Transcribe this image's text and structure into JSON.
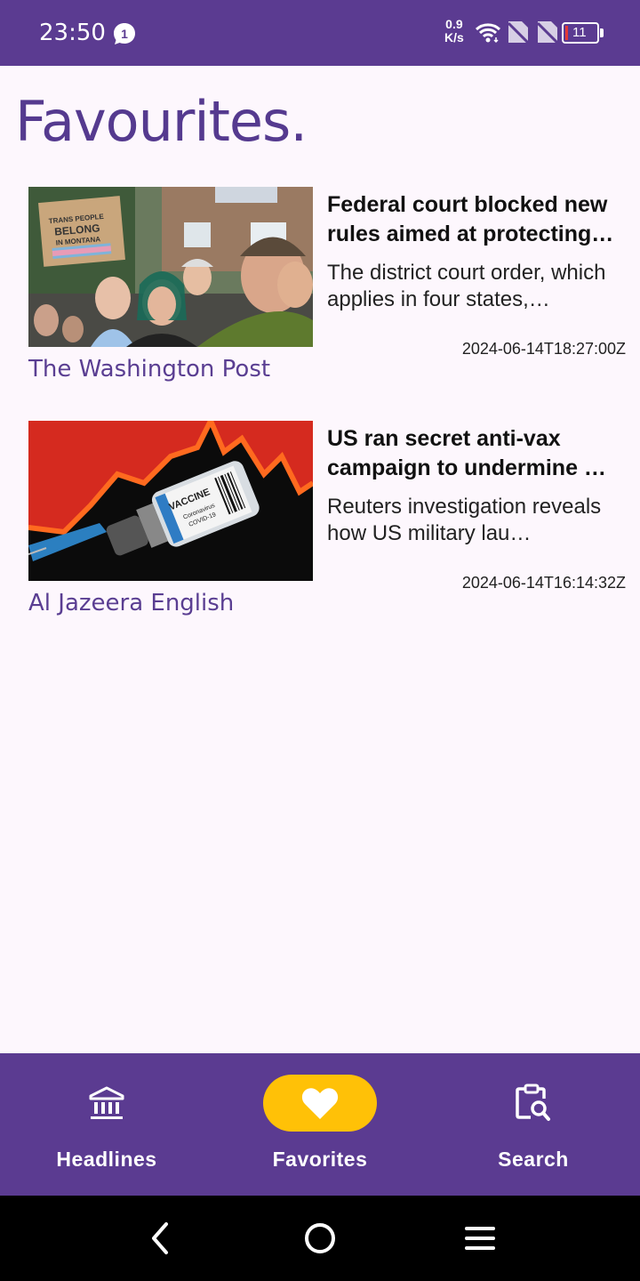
{
  "status_bar": {
    "time": "23:50",
    "notification_count": "1",
    "net_speed_value": "0.9",
    "net_speed_unit": "K/s",
    "battery_level": "11",
    "icons": [
      "message-bubble-icon",
      "wifi-icon",
      "no-sim-icon",
      "no-sim-icon",
      "battery-icon"
    ]
  },
  "page": {
    "title": "Favourites."
  },
  "articles": [
    {
      "headline": "Federal court blocked new rules aimed at protecting…",
      "summary": "The district court order, which applies in four states,…",
      "timestamp": "2024-06-14T18:27:00Z",
      "source": "The Washington Post",
      "image_sign_text": "TRANS PEOPLE BELONG IN MONTANA"
    },
    {
      "headline": "US ran secret anti-vax campaign to undermine …",
      "summary": "Reuters investigation reveals how US military lau…",
      "timestamp": "2024-06-14T16:14:32Z",
      "source": "Al Jazeera English",
      "image_label_text": "VACCINE Coronavirus COVID-19"
    }
  ],
  "bottom_nav": {
    "items": [
      {
        "label": "Headlines",
        "icon": "bank-icon",
        "active": false
      },
      {
        "label": "Favorites",
        "icon": "heart-icon",
        "active": true
      },
      {
        "label": "Search",
        "icon": "clipboard-search-icon",
        "active": false
      }
    ]
  },
  "system_nav": {
    "icons": [
      "back-icon",
      "home-icon",
      "menu-icon"
    ]
  },
  "colors": {
    "primary": "#5b3b91",
    "accent": "#ffc107",
    "background": "#fdf7fd",
    "source_text": "#5a3e92"
  }
}
